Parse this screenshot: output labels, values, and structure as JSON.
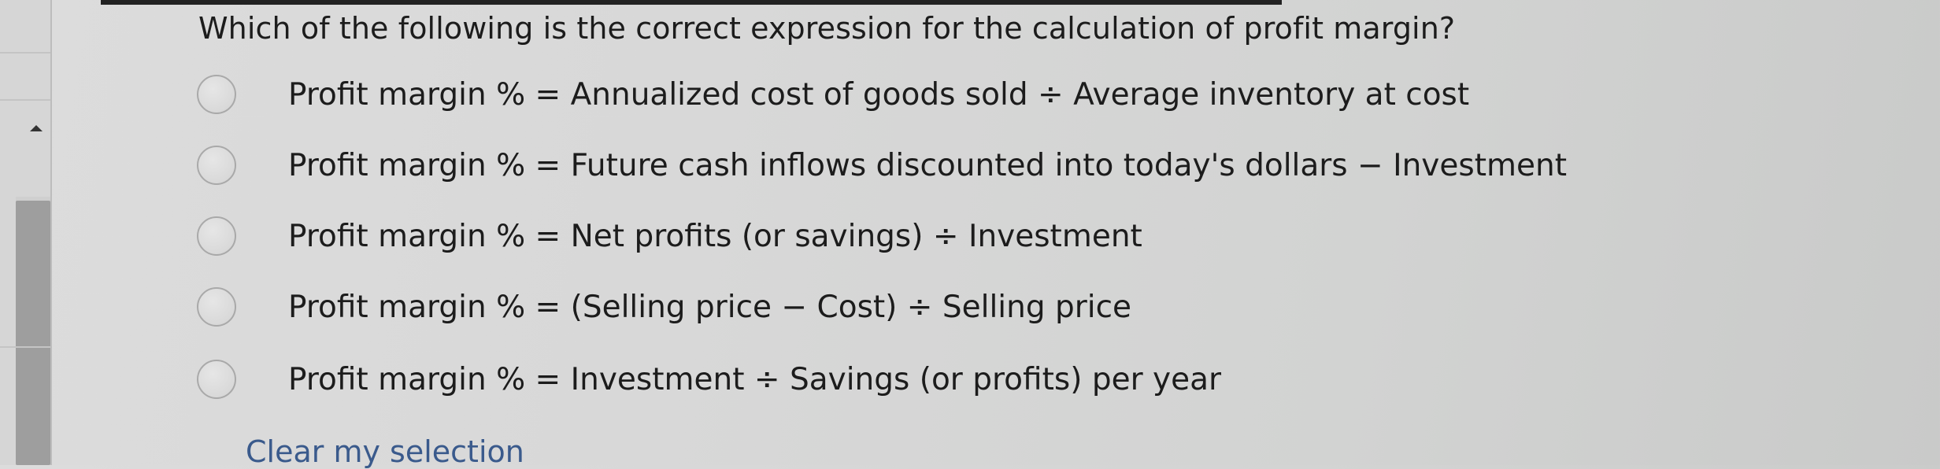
{
  "question": {
    "text": "Which of the following is the correct expression for the calculation of profit margin?"
  },
  "options": [
    {
      "label": "Profit margin % = Annualized cost of goods sold ÷ Average inventory at cost"
    },
    {
      "label": "Profit margin % = Future cash inflows discounted into today's dollars − Investment"
    },
    {
      "label": "Profit margin % = Net profits (or savings) ÷ Investment"
    },
    {
      "label": "Profit margin % = (Selling price − Cost) ÷ Selling price"
    },
    {
      "label": "Profit margin % = Investment ÷ Savings (or profits) per year"
    }
  ],
  "clear_selection": {
    "label": "Clear my selection"
  },
  "icons": {
    "scroll_up": "chevron-up-icon",
    "radio": "radio-unchecked-icon"
  },
  "colors": {
    "link": "#3a5a8c",
    "text": "#1c1c1c"
  }
}
